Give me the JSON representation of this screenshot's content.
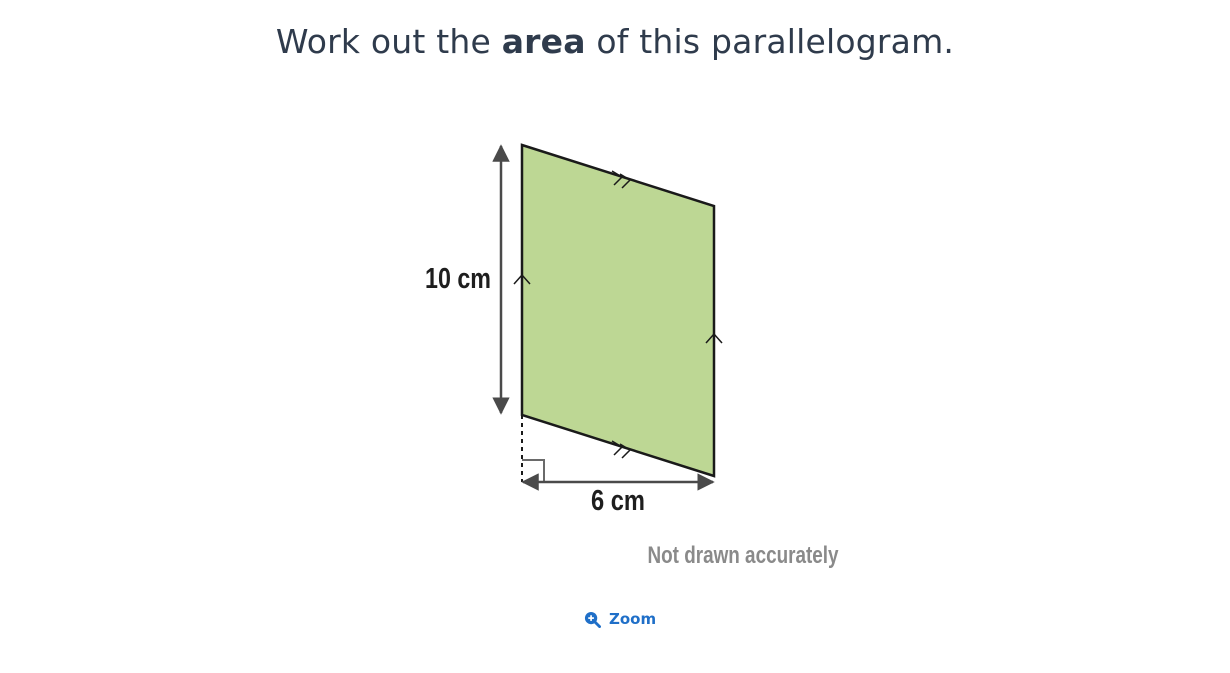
{
  "question": {
    "before": "Work out the ",
    "bold": "area",
    "after": " of this parallelogram."
  },
  "diagram": {
    "height_label": "10 cm",
    "base_label": "6 cm",
    "note": "Not drawn accurately",
    "fill_color": "#bdd794"
  },
  "zoom": {
    "label": "Zoom",
    "icon": "zoom-in-icon",
    "color": "#1f6fc8"
  }
}
